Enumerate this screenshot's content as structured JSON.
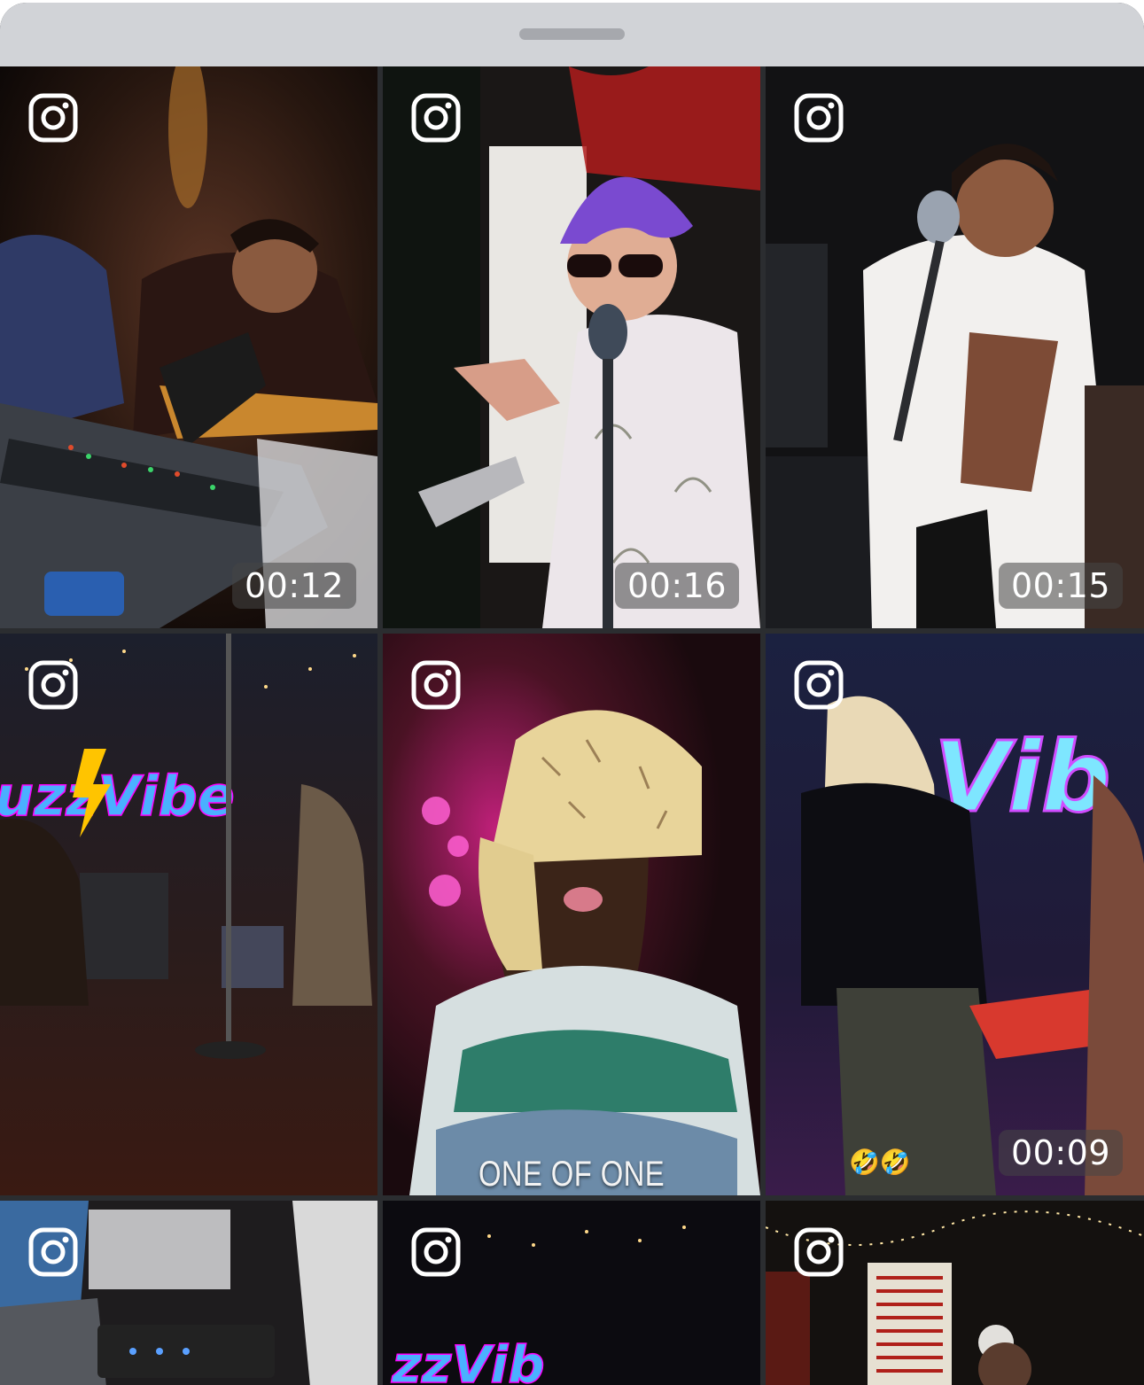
{
  "sheet": {
    "title": ""
  },
  "tiles": [
    {
      "source_icon": "instagram-icon",
      "duration": "00:12"
    },
    {
      "source_icon": "instagram-icon",
      "duration": "00:16"
    },
    {
      "source_icon": "instagram-icon",
      "duration": "00:15"
    },
    {
      "source_icon": "instagram-icon",
      "duration": ""
    },
    {
      "source_icon": "instagram-icon",
      "caption": "ONE OF ONE"
    },
    {
      "source_icon": "instagram-icon",
      "duration": "00:09",
      "emoji": "🤣🤣"
    },
    {
      "source_icon": "instagram-icon"
    },
    {
      "source_icon": "instagram-icon"
    },
    {
      "source_icon": "instagram-icon"
    }
  ],
  "neon_signs": [
    "uzzVibe",
    "Vib",
    "zzVib"
  ],
  "colors": {
    "header": "#d1d3d7",
    "grabber": "#a6a8ad",
    "grid_gap": "#2b2d30"
  }
}
